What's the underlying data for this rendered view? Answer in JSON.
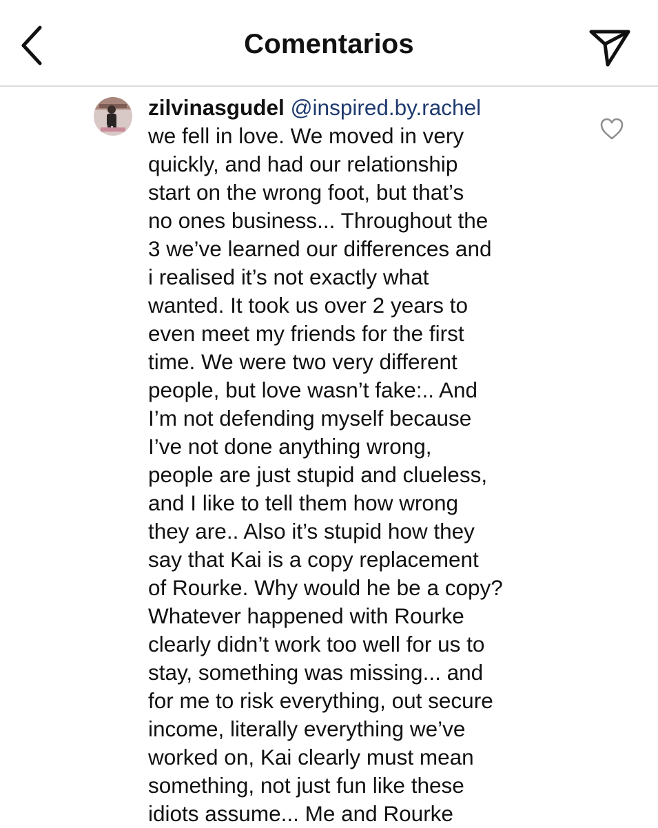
{
  "header": {
    "title": "Comentarios",
    "back_icon": "chevron-left-icon",
    "send_icon": "paper-plane-icon"
  },
  "comment": {
    "username": "zilvinasgudel",
    "mention": "@inspired.by.rachel",
    "text": "we fell in love. We moved in very\nquickly, and had our relationship\nstart on the wrong foot, but that’s\nno ones business... Throughout the\n3 we’ve learned our differences and\ni realised it’s not exactly what\nwanted. It took us over 2 years to\neven meet my friends for the first\ntime. We were two very different\npeople, but love wasn’t fake:.. And\nI’m not defending myself because\nI’ve not done anything wrong,\npeople are just stupid and clueless,\nand I like to tell them how wrong\nthey are.. Also it’s stupid how they\nsay that Kai is a copy replacement\nof Rourke. Why would he be a copy?\nWhatever happened with Rourke\nclearly didn’t work too well for us to\nstay, something was missing... and\nfor me to risk everything, out secure\nincome, literally everything we’ve\nworked on, Kai clearly must mean\nsomething, not just fun like these\nidiots assume... Me and Rourke",
    "like_icon": "heart-outline-icon"
  },
  "colors": {
    "text": "#111111",
    "mention": "#1e3a6e",
    "divider": "#dbdbdb",
    "icon": "#8e8e8e"
  }
}
